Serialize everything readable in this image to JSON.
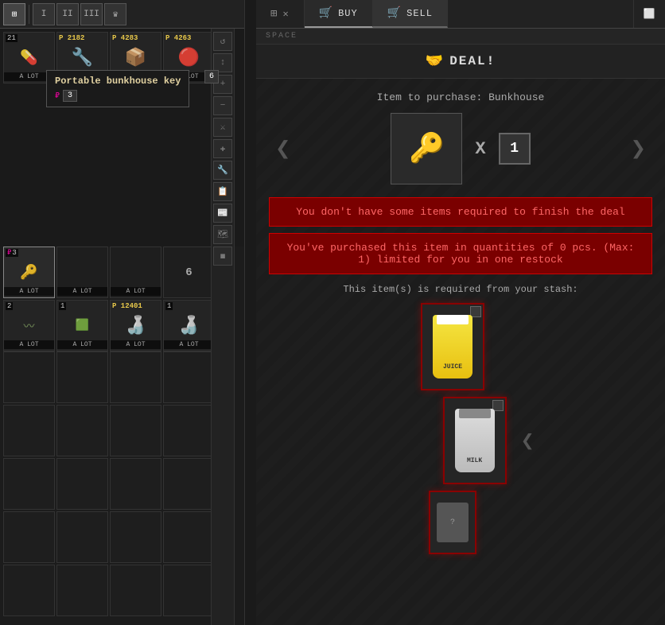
{
  "toolbar": {
    "btn1": "⊞",
    "btn2": "I",
    "btn3": "II",
    "btn4": "III",
    "btn5": "♛"
  },
  "inventory": {
    "rows": [
      [
        {
          "count": "21",
          "price": null,
          "label": "A LOT",
          "type": "pills",
          "icon": "💊"
        },
        {
          "count": null,
          "price": "2182",
          "label": "A LOT",
          "type": "tape",
          "icon": "🔧"
        },
        {
          "count": null,
          "price": "4283",
          "label": "A LOT",
          "type": "tape2",
          "icon": "🔧"
        },
        {
          "count": null,
          "price": "4263",
          "label": "A LOT",
          "type": "wire",
          "icon": "🔌"
        }
      ],
      [
        {
          "count": "3",
          "price": null,
          "label": "A LOT",
          "type": "key",
          "icon": "🔑"
        },
        {
          "count": null,
          "price": null,
          "label": "A LOT",
          "type": "empty2",
          "icon": ""
        },
        {
          "count": null,
          "price": null,
          "label": "A LOT",
          "type": "empty3",
          "icon": ""
        },
        {
          "count": null,
          "price": null,
          "label": "",
          "type": "badge6",
          "icon": "6"
        }
      ],
      [
        {
          "count": "2",
          "price": null,
          "label": "A LOT",
          "type": "rope",
          "icon": "〰"
        },
        {
          "count": "1",
          "price": null,
          "label": "A LOT",
          "type": "food",
          "icon": "🥫"
        },
        {
          "count": null,
          "price": "12401",
          "label": "A LOT",
          "type": "water",
          "icon": "🍶"
        },
        {
          "count": "1",
          "price": null,
          "label": "A LOT",
          "type": "water2",
          "icon": "🍶"
        }
      ]
    ]
  },
  "tooltip": {
    "title": "Portable bunkhouse key",
    "badge_num": "6",
    "ruble_icon": "₽",
    "count": "3"
  },
  "right_panel": {
    "tabs": [
      {
        "label": "BUY",
        "icon": "🛒",
        "active": true
      },
      {
        "label": "SELL",
        "icon": "💰",
        "active": false
      }
    ],
    "space_label": "SPACE",
    "deal_icon": "🤝",
    "deal_title": "DEAL!",
    "item_to_purchase": "Item to purchase: Bunkhouse",
    "quantity": "1",
    "multiply": "X",
    "error1": "You don't have some items required to finish the deal",
    "error2": "You've purchased this item in quantities of 0 pcs. (Max: 1) limited for you in one restock",
    "required_label": "This item(s) is required from your stash:"
  },
  "side_icons": [
    "↺",
    "↕",
    "+",
    "−",
    "⚔",
    "✚",
    "🔧",
    "📋",
    "📰",
    "🗺",
    "◼"
  ]
}
